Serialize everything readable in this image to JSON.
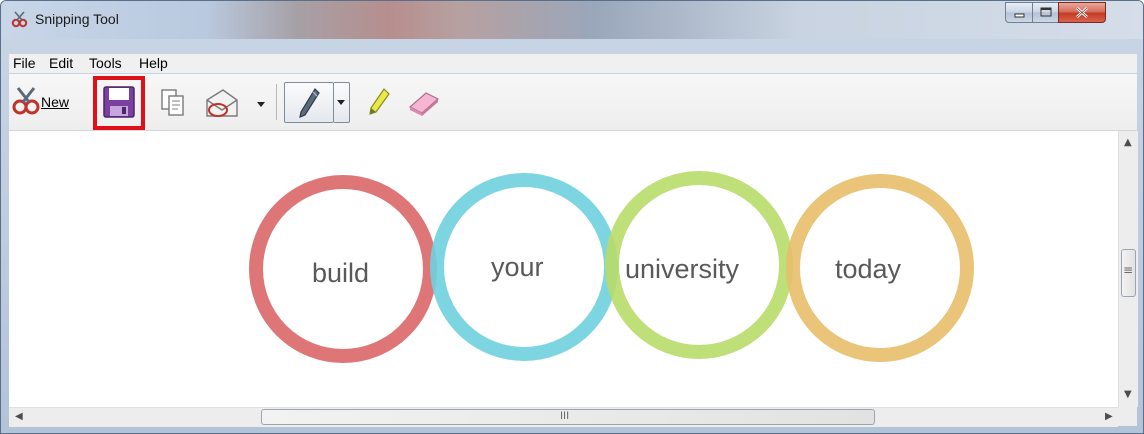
{
  "window": {
    "title": "Snipping Tool",
    "title_icon": "scissors-icon"
  },
  "window_controls": {
    "minimize_icon": "minimize-icon",
    "maximize_icon": "maximize-icon",
    "close_icon": "close-icon"
  },
  "menu": [
    "File",
    "Edit",
    "Tools",
    "Help"
  ],
  "toolbar": {
    "new_label": "New",
    "icons": [
      "new-snip-icon",
      "save-icon",
      "copy-icon",
      "send-snip-icon",
      "dropdown-arrow-icon",
      "pen-icon",
      "highlighter-icon",
      "eraser-icon"
    ],
    "highlight_color": "#e0101a"
  },
  "canvas": {
    "circles": [
      {
        "word": "build",
        "color": "#dc6f71"
      },
      {
        "word": "your",
        "color": "#6fd0df"
      },
      {
        "word": "university",
        "color": "#b8db6a"
      },
      {
        "word": "today",
        "color": "#e8be6a"
      }
    ]
  },
  "scrollbars": {
    "vertical_grip": "≡",
    "horizontal_grip": "III"
  }
}
